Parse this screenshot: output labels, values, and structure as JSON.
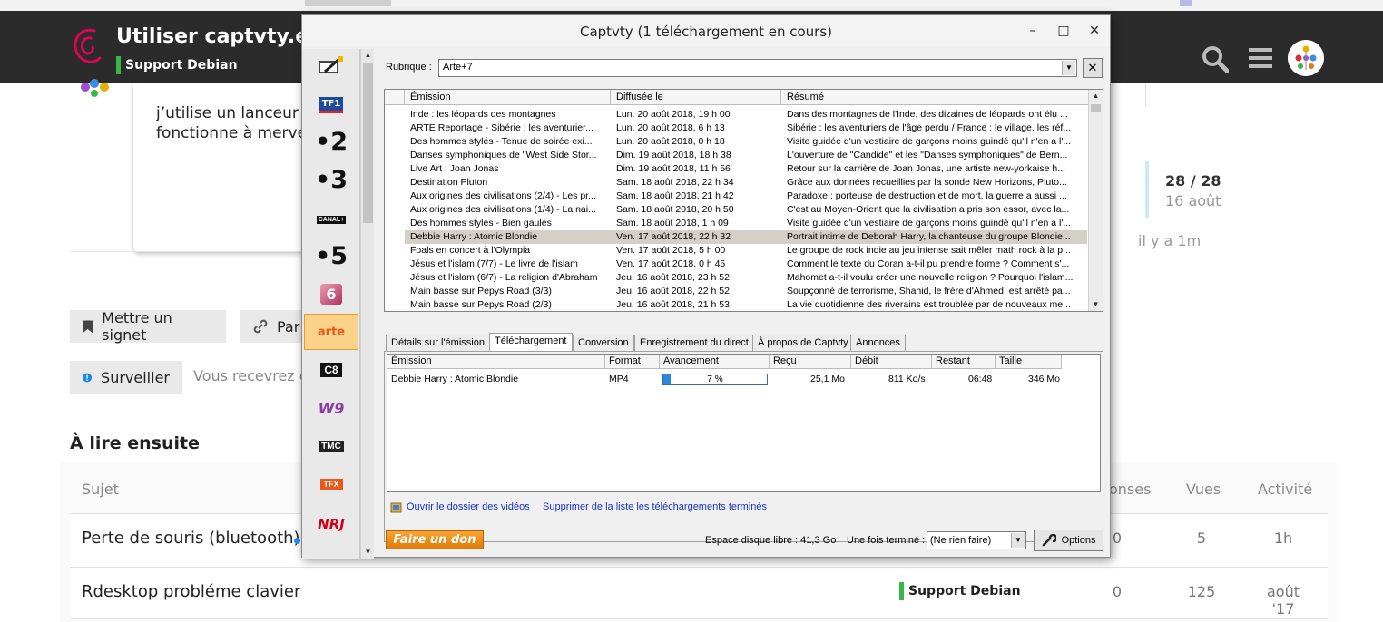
{
  "forum": {
    "topic_title": "Utiliser captvty.exe",
    "category": "Support Debian",
    "post_text": "j'utilise un lanceur p\nfonctionne à mervei",
    "bookmark_label": "Mettre un signet",
    "share_label": "Par",
    "watch_label": "Surveiller",
    "watch_info": "Vous recevrez c",
    "timeline": {
      "count": "28 / 28",
      "date": "16 août",
      "ago": "il y a 1m"
    },
    "suggested_heading": "À lire ensuite",
    "columns": {
      "subject": "Sujet",
      "replies": "onses",
      "views": "Vues",
      "activity": "Activité"
    },
    "topics": [
      {
        "title": "Perte de souris (bluetooth)",
        "category": "",
        "replies": "0",
        "views": "5",
        "activity": "1h"
      },
      {
        "title": "Rdesktop probléme clavier",
        "category": "Support Debian",
        "replies": "0",
        "views": "125",
        "activity": "août '17"
      }
    ],
    "colors": {
      "header_bg": "#2b2b2b",
      "category_green": "#3ab54a",
      "unread_blue": "#1e90ff"
    }
  },
  "captvty": {
    "title": "Captvty (1 téléchargement en cours)",
    "controls": {
      "minimize": "–",
      "maximize": "□",
      "close": "✕"
    },
    "channels": [
      {
        "name": "record-icon",
        "label": ""
      },
      {
        "name": "tf1",
        "label": "TF1"
      },
      {
        "name": "france2",
        "label": "•2"
      },
      {
        "name": "france3",
        "label": "•3"
      },
      {
        "name": "canalplus",
        "label": "CANAL+"
      },
      {
        "name": "france5",
        "label": "•5"
      },
      {
        "name": "m6",
        "label": "6"
      },
      {
        "name": "arte",
        "label": "arte"
      },
      {
        "name": "c8",
        "label": "C8"
      },
      {
        "name": "w9",
        "label": "W9"
      },
      {
        "name": "tmc",
        "label": "TMC"
      },
      {
        "name": "tfx",
        "label": "TFX"
      },
      {
        "name": "nrj12",
        "label": "NRJ"
      }
    ],
    "rubrique_label": "Rubrique :",
    "rubrique_value": "Arte+7",
    "emissions": {
      "headers": {
        "title": "Émission",
        "aired": "Diffusée le",
        "summary": "Résumé"
      },
      "rows": [
        {
          "title": "Inde : les léopards des montagnes",
          "aired": "Lun. 20 août 2018, 19 h 00",
          "summary": "Dans des montagnes de l'Inde, des dizaines de léopards ont élu ..."
        },
        {
          "title": "ARTE Reportage - Sibérie : les aventurier...",
          "aired": "Lun. 20 août 2018, 6 h 13",
          "summary": "Sibérie : les aventuriers de l'âge perdu / France : le village, les réf..."
        },
        {
          "title": "Des hommes stylés - Tenue de soirée exi...",
          "aired": "Lun. 20 août 2018, 0 h 18",
          "summary": "Visite guidée d'un vestiaire de garçons moins guindé qu'il n'en a l'..."
        },
        {
          "title": "Danses symphoniques de \"West Side Stor...",
          "aired": "Dim. 19 août 2018, 18 h 38",
          "summary": "L'ouverture de \"Candide\" et les \"Danses symphoniques\" de Bern..."
        },
        {
          "title": "Live Art : Joan Jonas",
          "aired": "Dim. 19 août 2018, 11 h 56",
          "summary": "Retour sur la carrière de Joan Jonas, une artiste new-yorkaise h..."
        },
        {
          "title": "Destination Pluton",
          "aired": "Sam. 18 août 2018, 22 h 34",
          "summary": "Grâce aux données recueillies par la sonde New Horizons, Pluto..."
        },
        {
          "title": "Aux origines des civilisations (2/4) - Les pr...",
          "aired": "Sam. 18 août 2018, 21 h 42",
          "summary": "Paradoxe : porteuse de destruction et de mort, la guerre a aussi ..."
        },
        {
          "title": "Aux origines des civilisations (1/4) - La nai...",
          "aired": "Sam. 18 août 2018, 20 h 50",
          "summary": "C'est au Moyen-Orient que la civilisation a pris son essor, avec la..."
        },
        {
          "title": "Des hommes stylés - Bien gaulés",
          "aired": "Sam. 18 août 2018, 1 h 09",
          "summary": "Visite guidée d'un vestiaire de garçons moins guindé qu'il n'en a l'..."
        },
        {
          "title": "Debbie Harry : Atomic Blondie",
          "aired": "Ven. 17 août 2018, 22 h 32",
          "summary": "Portrait intime de Deborah Harry, la chanteuse du groupe Blondie..."
        },
        {
          "title": "Foals en concert à l'Olympia",
          "aired": "Ven. 17 août 2018, 5 h 00",
          "summary": "Le groupe de rock indie au jeu intense sait mêler math rock à la p..."
        },
        {
          "title": "Jésus et l'islam (7/7) - Le livre de l'islam",
          "aired": "Ven. 17 août 2018, 0 h 45",
          "summary": "Comment le texte du Coran a-t-il pu prendre forme ? Comment s'..."
        },
        {
          "title": "Jésus et l'islam (6/7) - La religion d'Abraham",
          "aired": "Jeu. 16 août 2018, 23 h 52",
          "summary": "Mahomet a-t-il voulu créer une nouvelle religion ? Pourquoi l'islam..."
        },
        {
          "title": "Main basse sur Pepys Road (3/3)",
          "aired": "Jeu. 16 août 2018, 22 h 52",
          "summary": "Soupçonné de terrorisme, Shahid, le frère d'Ahmed, est arrêté pa..."
        },
        {
          "title": "Main basse sur Pepys Road (2/3)",
          "aired": "Jeu. 16 août 2018, 21 h 53",
          "summary": "La vie quotidienne des riverains est troublée par de nouveaux me..."
        }
      ]
    },
    "tabs": [
      "Détails sur l'émission",
      "Téléchargement",
      "Conversion",
      "Enregistrement du direct",
      "À propos de Captvty",
      "Annonces"
    ],
    "downloads": {
      "headers": {
        "title": "Émission",
        "format": "Format",
        "progress": "Avancement",
        "received": "Reçu",
        "rate": "Débit",
        "remaining": "Restant",
        "size": "Taille"
      },
      "rows": [
        {
          "title": "Debbie Harry : Atomic Blondie",
          "format": "MP4",
          "progress_label": "7 %",
          "progress_fraction": 0.07,
          "received": "25,1 Mo",
          "rate": "811 Ko/s",
          "remaining": "06:48",
          "size": "346 Mo"
        }
      ]
    },
    "links": {
      "open_folder": "Ouvrir le dossier des vidéos",
      "clear_finished": "Supprimer de la liste les téléchargements terminés"
    },
    "donate_label": "Faire un don",
    "disk_space": "Espace disque libre : 41,3 Go",
    "when_done_label": "Une fois terminé :",
    "when_done_value": "(Ne rien faire)",
    "options_label": "Options",
    "colors": {
      "selected_channel": "#fbd28a",
      "selected_row": "#d4cfc7",
      "progress": "#2d88d8",
      "link": "#1a33c4",
      "donate": "#f39218"
    }
  }
}
